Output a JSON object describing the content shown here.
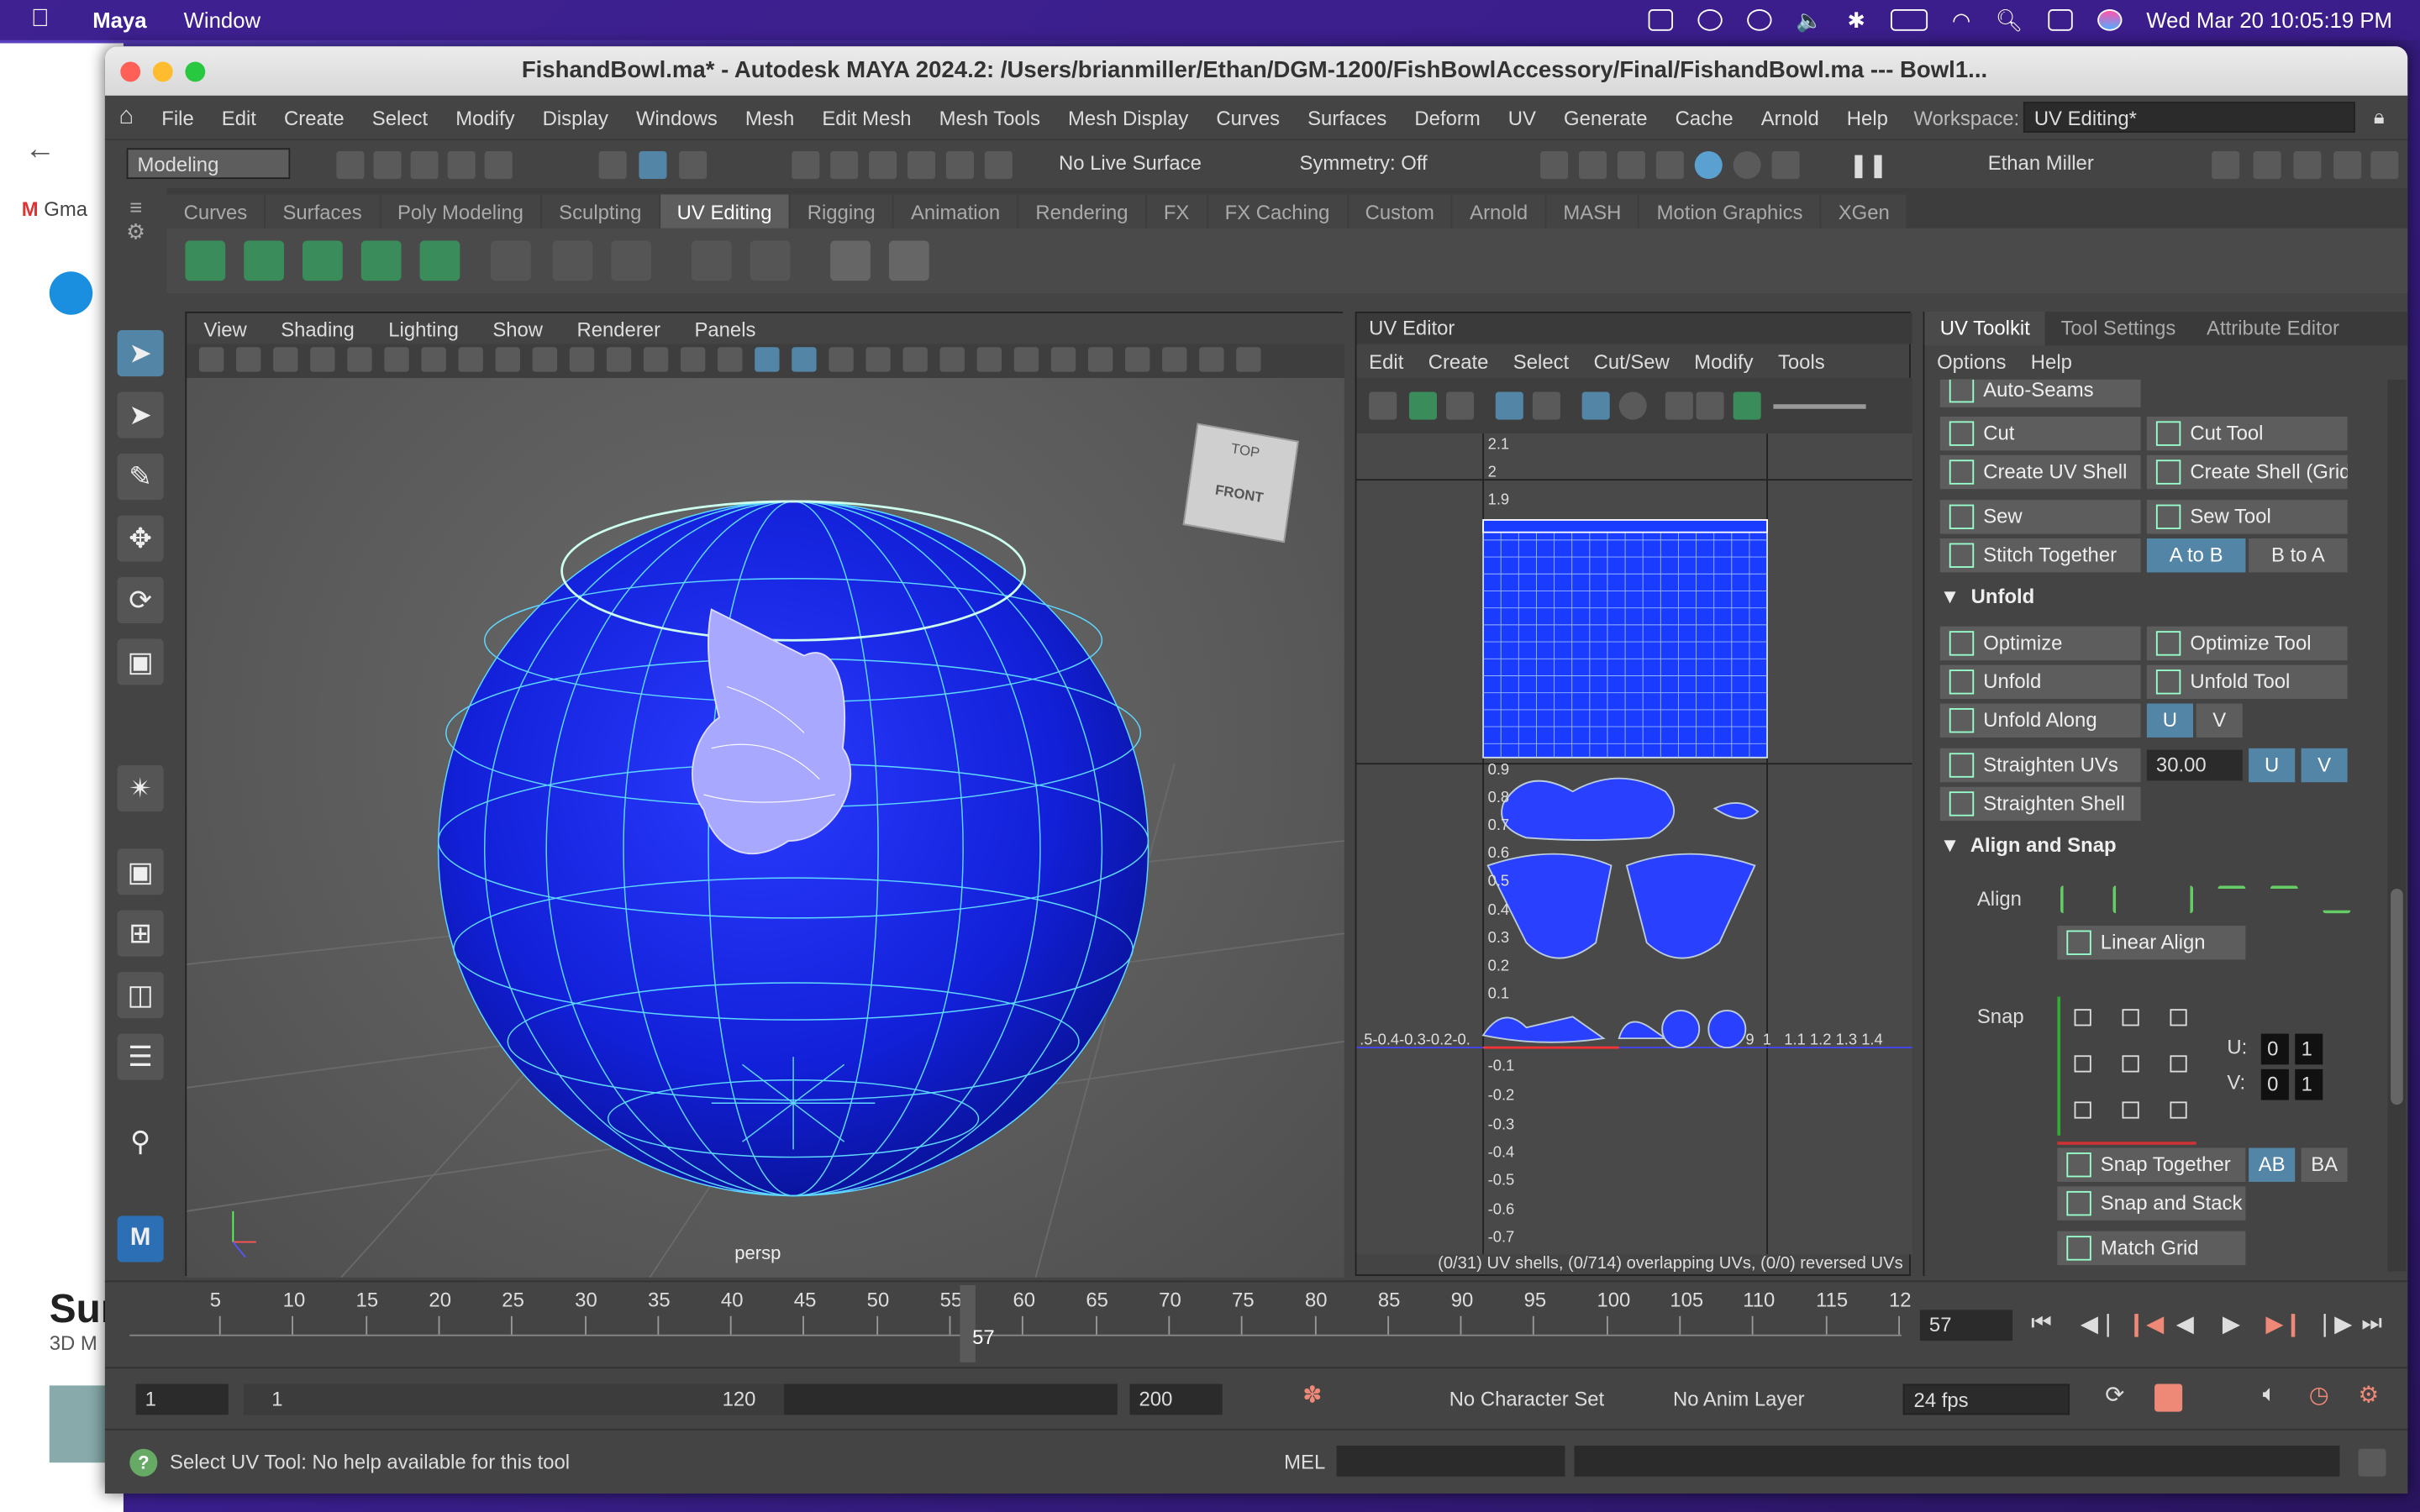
{
  "menubar": {
    "app": "Maya",
    "window": "Window",
    "datetime": "Wed Mar 20  10:05:19 PM"
  },
  "browser": {
    "gmail": "Gma",
    "sun": "Sur",
    "sub": "3D M"
  },
  "title": "FishandBowl.ma* - Autodesk MAYA 2024.2: /Users/brianmiller/Ethan/DGM-1200/FishBowlAccessory/Final/FishandBowl.ma   ---   Bowl1...",
  "main_menu": [
    "File",
    "Edit",
    "Create",
    "Select",
    "Modify",
    "Display",
    "Windows",
    "Mesh",
    "Edit Mesh",
    "Mesh Tools",
    "Mesh Display",
    "Curves",
    "Surfaces",
    "Deform",
    "UV",
    "Generate",
    "Cache",
    "Arnold",
    "Help"
  ],
  "workspace": {
    "label": "Workspace:",
    "value": "UV Editing*"
  },
  "status": {
    "mode": "Modeling",
    "live_surface": "No Live Surface",
    "symmetry": "Symmetry: Off",
    "user": "Ethan Miller"
  },
  "shelf_tabs": [
    "Curves",
    "Surfaces",
    "Poly Modeling",
    "Sculpting",
    "UV Editing",
    "Rigging",
    "Animation",
    "Rendering",
    "FX",
    "FX Caching",
    "Custom",
    "Arnold",
    "MASH",
    "Motion Graphics",
    "XGen"
  ],
  "shelf_active": "UV Editing",
  "viewport": {
    "menu": [
      "View",
      "Shading",
      "Lighting",
      "Show",
      "Renderer",
      "Panels"
    ],
    "camera": "persp",
    "cube_top": "TOP",
    "cube_front": "FRONT"
  },
  "uv_editor": {
    "title": "UV Editor",
    "menu": [
      "Edit",
      "Create",
      "Select",
      "Cut/Sew",
      "Modify",
      "Tools"
    ],
    "y_ticks": [
      "2.1",
      "2",
      "1.9",
      "0.9",
      "0.8",
      "0.7",
      "0.6",
      "0.5",
      "0.4",
      "0.3",
      "0.2",
      "0.1",
      "-0.1",
      "-0.2",
      "-0.3",
      "-0.4",
      "-0.5",
      "-0.6",
      "-0.7"
    ],
    "x_ticks": ".5-0.4-0.3-0.2-0.",
    "x_ticks_right": "9  1   1.1 1.2 1.3 1.4",
    "status": "(0/31) UV shells, (0/714) overlapping UVs, (0/0) reversed UVs"
  },
  "toolkit": {
    "tabs": [
      "UV Toolkit",
      "Tool Settings",
      "Attribute Editor"
    ],
    "menu": [
      "Options",
      "Help"
    ],
    "auto_seams": "Auto-Seams",
    "cut": "Cut",
    "cut_tool": "Cut Tool",
    "create_shell": "Create UV Shell",
    "create_shell_grid": "Create Shell (Grid)",
    "sew": "Sew",
    "sew_tool": "Sew Tool",
    "stitch": "Stitch Together",
    "a_to_b": "A to B",
    "b_to_a": "B to A",
    "unfold_hdr": "Unfold",
    "optimize": "Optimize",
    "optimize_tool": "Optimize Tool",
    "unfold": "Unfold",
    "unfold_tool": "Unfold Tool",
    "unfold_along": "Unfold Along",
    "u": "U",
    "v": "V",
    "straighten_uvs": "Straighten UVs",
    "straighten_val": "30.00",
    "straighten_shell": "Straighten Shell",
    "align_snap_hdr": "Align and Snap",
    "align": "Align",
    "linear_align": "Linear Align",
    "snap": "Snap",
    "u_label": "U:",
    "v_label": "V:",
    "u0": "0",
    "u1": "1",
    "v0": "0",
    "v1": "1",
    "snap_together": "Snap Together",
    "ab": "AB",
    "ba": "BA",
    "snap_stack": "Snap and Stack",
    "match_grid": "Match Grid"
  },
  "timeline": {
    "ticks": [
      "5",
      "10",
      "15",
      "20",
      "25",
      "30",
      "35",
      "40",
      "45",
      "50",
      "55",
      "60",
      "65",
      "70",
      "75",
      "80",
      "85",
      "90",
      "95",
      "100",
      "105",
      "110",
      "115",
      "12"
    ],
    "current_marker": "57",
    "current_frame": "57"
  },
  "range": {
    "start": "1",
    "inner_start": "1",
    "inner_end": "120",
    "end": "200",
    "char_set": "No Character Set",
    "anim_layer": "No Anim Layer",
    "fps": "24 fps"
  },
  "helpline": {
    "text": "Select UV Tool: No help available for this tool",
    "mel": "MEL"
  },
  "colors": {
    "mesh_blue": "#1f2fe0",
    "wire": "#5fd8ff",
    "accent": "#5285a6"
  }
}
